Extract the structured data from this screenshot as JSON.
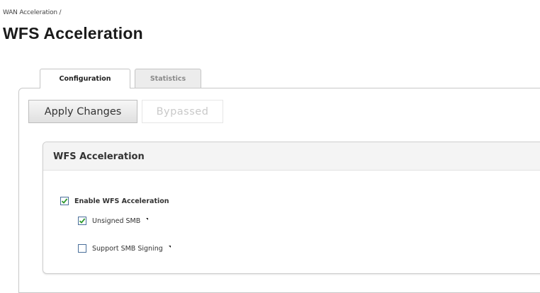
{
  "breadcrumb": "WAN Acceleration /",
  "page_title": "WFS Acceleration",
  "tabs": [
    {
      "label": "Configuration",
      "active": true
    },
    {
      "label": "Statistics",
      "active": false
    }
  ],
  "toolbar": {
    "apply_label": "Apply Changes",
    "bypassed_label": "Bypassed"
  },
  "section": {
    "title": "WFS Acceleration",
    "options": [
      {
        "label": "Enable WFS Acceleration",
        "checked": true
      },
      {
        "label": "Unsigned SMB",
        "checked": true
      },
      {
        "label": "Support SMB Signing",
        "checked": false
      }
    ]
  },
  "colors": {
    "checkbox_border": "#4a6f9a",
    "checkmark": "#2e9a2e",
    "disabled_text": "#c9c9c9"
  }
}
